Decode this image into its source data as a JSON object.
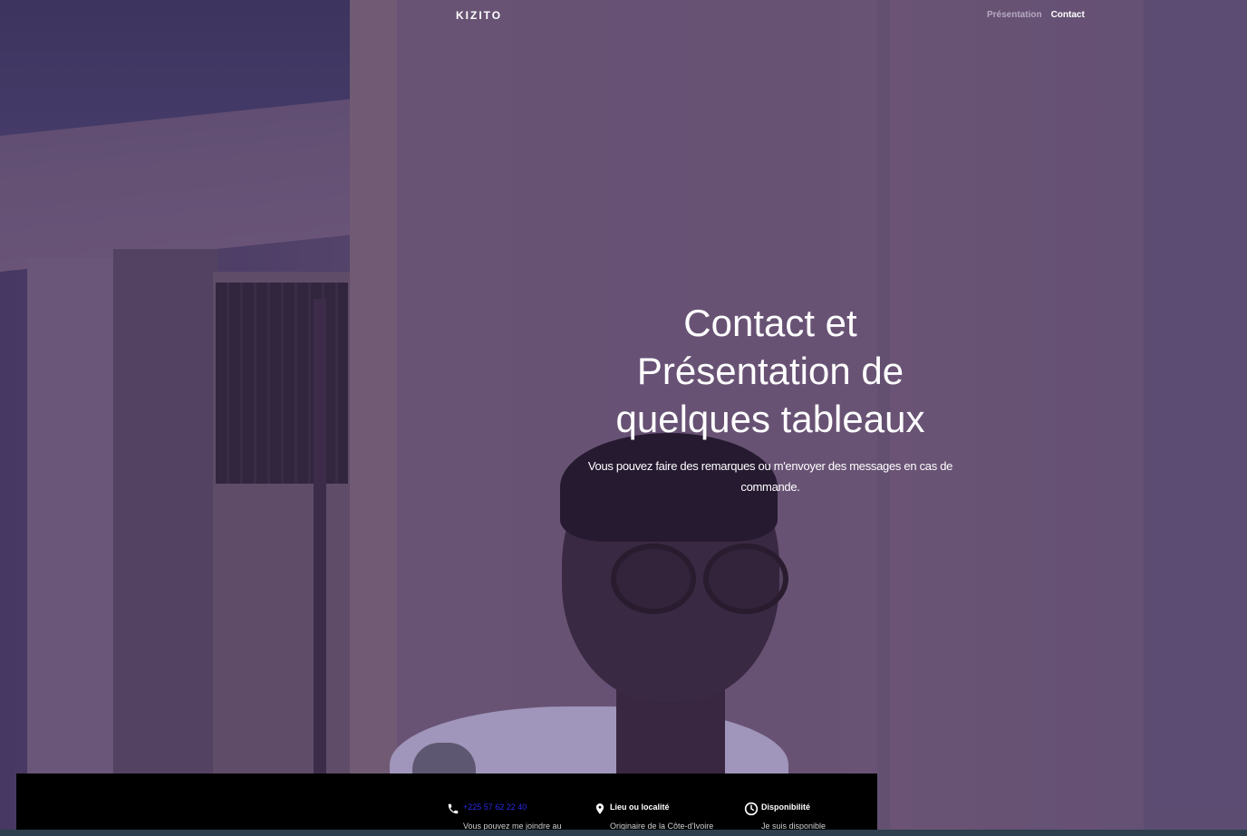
{
  "brand": "KIZITO",
  "nav": {
    "items": [
      {
        "label": "Présentation",
        "active": false
      },
      {
        "label": "Contact",
        "active": true
      }
    ]
  },
  "hero": {
    "title_lines": [
      "Contact et",
      "Présentation de",
      "quelques tableaux"
    ],
    "subtitle": "Vous pouvez faire des remarques ou m'envoyer des messages en cas de commande."
  },
  "info": [
    {
      "icon": "phone-icon",
      "heading": "+225 57 62 22 40",
      "text": "Vous pouvez me joindre au"
    },
    {
      "icon": "location-pin-icon",
      "heading": "Lieu ou localité",
      "text": "Originaire de la Côte-d'Ivoire"
    },
    {
      "icon": "clock-icon",
      "heading": "Disponibilité",
      "text": "Je suis disponible"
    }
  ],
  "colors": {
    "phone_link": "#2a2ae8",
    "infobar_bg": "#000000",
    "nav_muted": "#b7a9c2"
  }
}
